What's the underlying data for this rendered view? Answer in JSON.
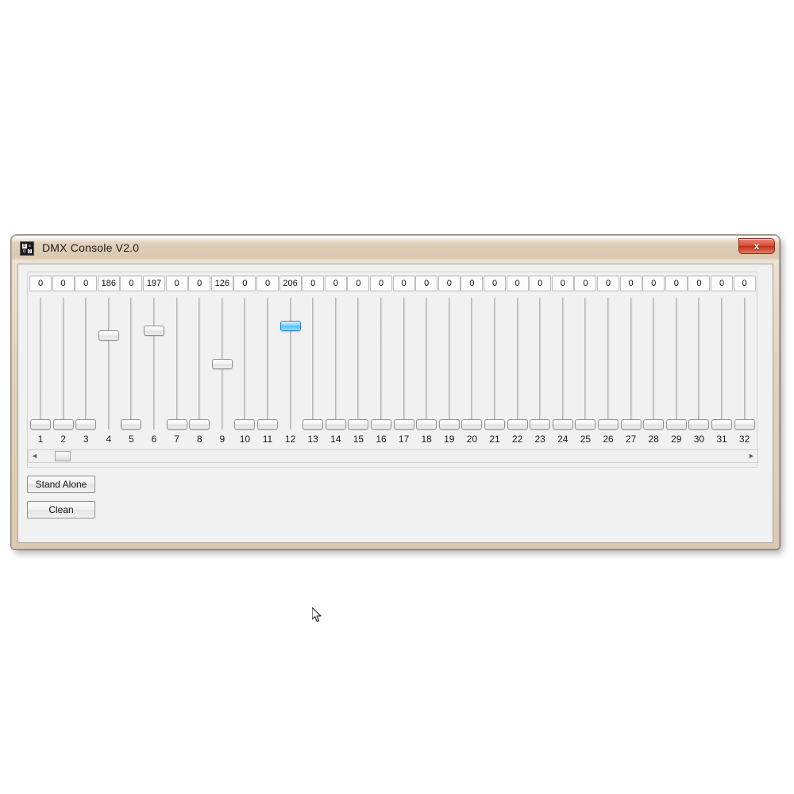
{
  "window": {
    "title": "DMX Console V2.0",
    "icon": "dmx-app-icon",
    "close_label": "x",
    "titlebar_color": "#dcc9b3",
    "frame_color": "#b9ad9e"
  },
  "channels": {
    "count": 32,
    "indices": [
      "1",
      "2",
      "3",
      "4",
      "5",
      "6",
      "7",
      "8",
      "9",
      "10",
      "11",
      "12",
      "13",
      "14",
      "15",
      "16",
      "17",
      "18",
      "19",
      "20",
      "21",
      "22",
      "23",
      "24",
      "25",
      "26",
      "27",
      "28",
      "29",
      "30",
      "31",
      "32"
    ],
    "values": [
      "0",
      "0",
      "0",
      "186",
      "0",
      "197",
      "0",
      "0",
      "126",
      "0",
      "0",
      "206",
      "0",
      "0",
      "0",
      "0",
      "0",
      "0",
      "0",
      "0",
      "0",
      "0",
      "0",
      "0",
      "0",
      "0",
      "0",
      "0",
      "0",
      "0",
      "0",
      "0"
    ],
    "numeric_values": [
      0,
      0,
      0,
      186,
      0,
      197,
      0,
      0,
      126,
      0,
      0,
      206,
      0,
      0,
      0,
      0,
      0,
      0,
      0,
      0,
      0,
      0,
      0,
      0,
      0,
      0,
      0,
      0,
      0,
      0,
      0,
      0
    ],
    "value_min": 0,
    "value_max": 255,
    "active_channel": 12,
    "active_color": "#54bdee"
  },
  "scrollbar": {
    "left_arrow": "◄",
    "right_arrow": "►",
    "thumb_position_percent": 2
  },
  "buttons": {
    "stand_alone": "Stand Alone",
    "clean": "Clean"
  }
}
